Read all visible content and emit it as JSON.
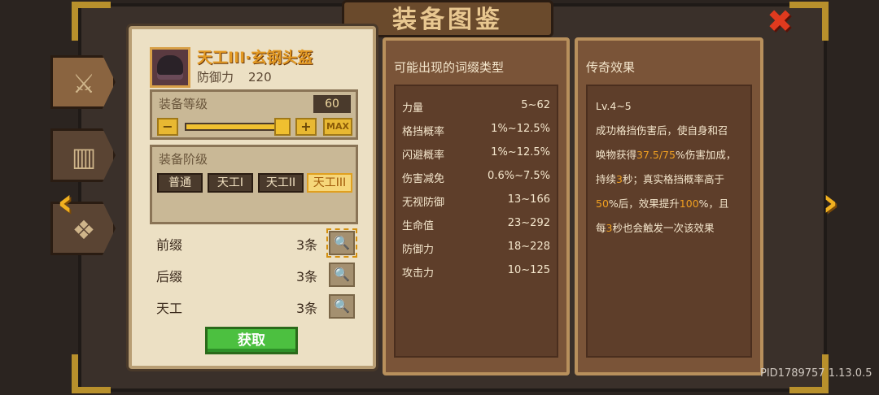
{
  "window": {
    "title": "装备图鉴"
  },
  "item": {
    "name": "天工III·玄钢头盔",
    "def_label": "防御力",
    "def_value": "220"
  },
  "level": {
    "label": "装备等级",
    "value": "60",
    "minus": "−",
    "plus": "+",
    "max": "MAX",
    "progress_percent": 100
  },
  "tier": {
    "label": "装备阶级",
    "options": [
      "普通",
      "天工I",
      "天工II",
      "天工III"
    ],
    "selected": "天工III"
  },
  "affixes": [
    {
      "name": "前缀",
      "count": "3条"
    },
    {
      "name": "后缀",
      "count": "3条"
    },
    {
      "name": "天工",
      "count": "3条"
    }
  ],
  "obtain_label": "获取",
  "possible_affixes": {
    "title": "可能出现的词缀类型",
    "rows": [
      {
        "k": "力量",
        "v": "5~62"
      },
      {
        "k": "格挡概率",
        "v": "1%~12.5%"
      },
      {
        "k": "闪避概率",
        "v": "1%~12.5%"
      },
      {
        "k": "伤害减免",
        "v": "0.6%~7.5%"
      },
      {
        "k": "无视防御",
        "v": "13~166"
      },
      {
        "k": "生命值",
        "v": "23~292"
      },
      {
        "k": "防御力",
        "v": "18~228"
      },
      {
        "k": "攻击力",
        "v": "10~125"
      }
    ]
  },
  "legendary": {
    "title": "传奇效果",
    "level_range": "Lv.4~5",
    "line1": "成功格挡伤害后，使自身和召",
    "line2a": "唤物获得",
    "line2b": "37.5/75",
    "line2c": "%伤害加成，",
    "line3a": "持续",
    "line3b": "3",
    "line3c": "秒；真实格挡概率高于",
    "line4a": "50",
    "line4b": "%后，效果提升",
    "line4c": "100",
    "line4d": "%，且",
    "line5a": "每",
    "line5b": "3",
    "line5c": "秒也会触发一次该效果"
  },
  "footer": {
    "pid": "PID1789757 1.13.0.5"
  },
  "icons": {
    "close": "close-icon",
    "sword": "sword-icon",
    "armor": "armor-icon",
    "accessory": "accessory-icon",
    "left_arrow": "chevron-left-icon",
    "right_arrow": "chevron-right-icon",
    "zoom": "magnifier-icon"
  },
  "colors": {
    "accent": "#e39a24",
    "highlight": "#f0a020",
    "get_button": "#4cc040",
    "close": "#e03a1e"
  }
}
